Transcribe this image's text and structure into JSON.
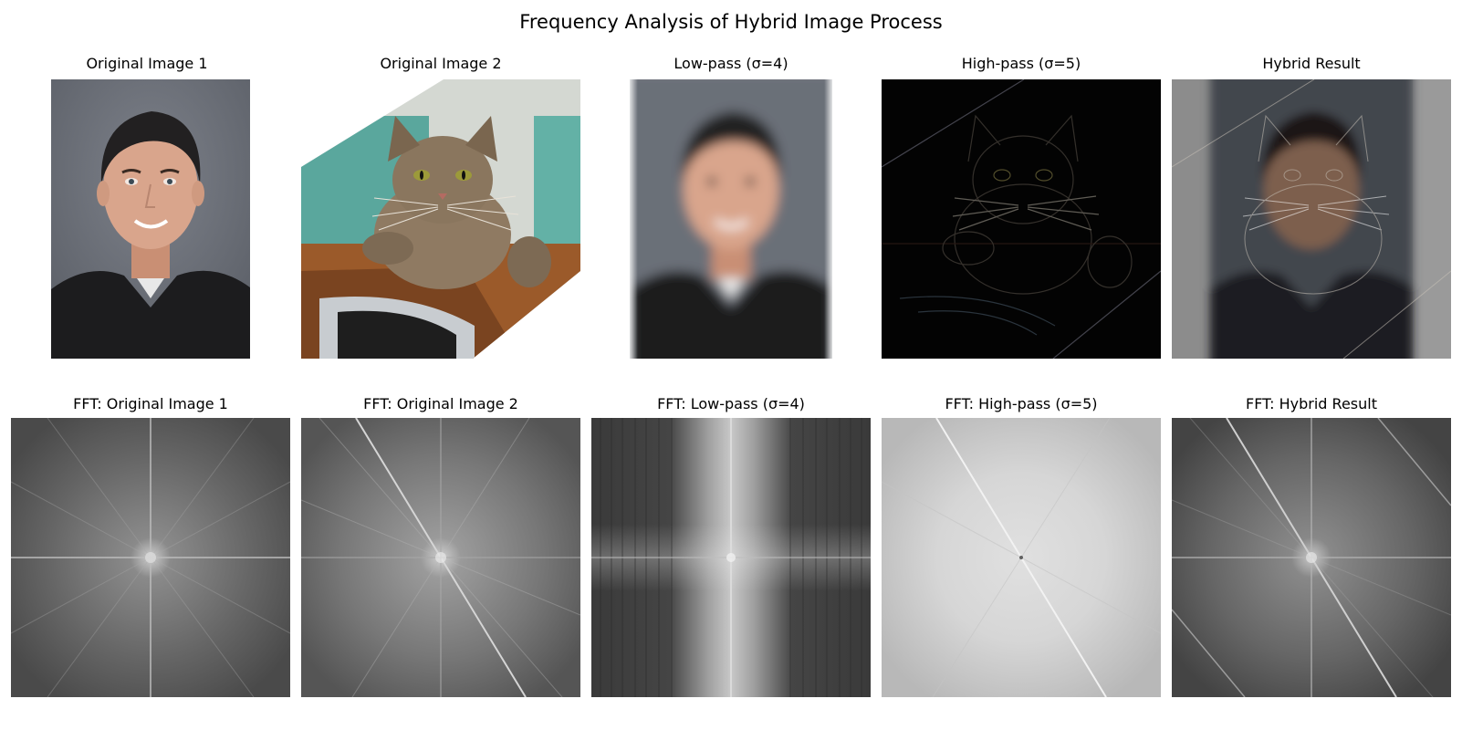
{
  "figure": {
    "title": "Frequency Analysis of Hybrid Image Process"
  },
  "row1": [
    {
      "title": "Original Image 1"
    },
    {
      "title": "Original Image 2"
    },
    {
      "title": "Low-pass (σ=4)"
    },
    {
      "title": "High-pass (σ=5)"
    },
    {
      "title": "Hybrid Result"
    }
  ],
  "row2": [
    {
      "title": "FFT: Original Image 1"
    },
    {
      "title": "FFT: Original Image 2"
    },
    {
      "title": "FFT: Low-pass (σ=4)"
    },
    {
      "title": "FFT: High-pass (σ=5)"
    },
    {
      "title": "FFT: Hybrid Result"
    }
  ],
  "colors": {
    "background": "#ffffff",
    "portrait_backdrop": "#6b6f78",
    "shirt": "#1c1c1e",
    "skin": "#d9a58c",
    "hair": "#222021",
    "cat_fur": "#8f7a62",
    "wall_teal": "#5aa79d",
    "wood": "#9b5a2a",
    "spectrum_dark": "#3d3d3d",
    "spectrum_light": "#d9d9d9"
  }
}
